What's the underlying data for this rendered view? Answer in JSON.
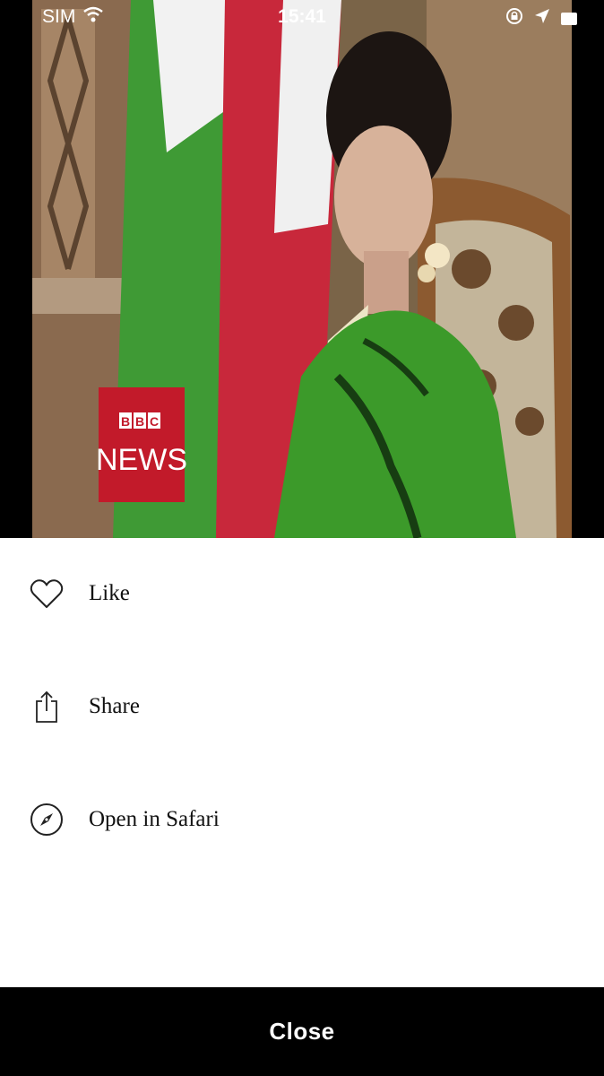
{
  "status_bar": {
    "carrier": "SIM",
    "time": "15:41"
  },
  "media": {
    "logo_text_line1": "BBC",
    "logo_text_line2": "NEWS",
    "colors": {
      "logo_background": "#c21a2a",
      "flag_green": "#3f9a35",
      "flag_red": "#c8283b",
      "dress_green": "#3c9a2a"
    }
  },
  "menu": {
    "items": [
      {
        "label": "Like",
        "icon": "heart-icon"
      },
      {
        "label": "Share",
        "icon": "share-icon"
      },
      {
        "label": "Open in Safari",
        "icon": "compass-icon"
      }
    ]
  },
  "footer": {
    "close_label": "Close"
  }
}
